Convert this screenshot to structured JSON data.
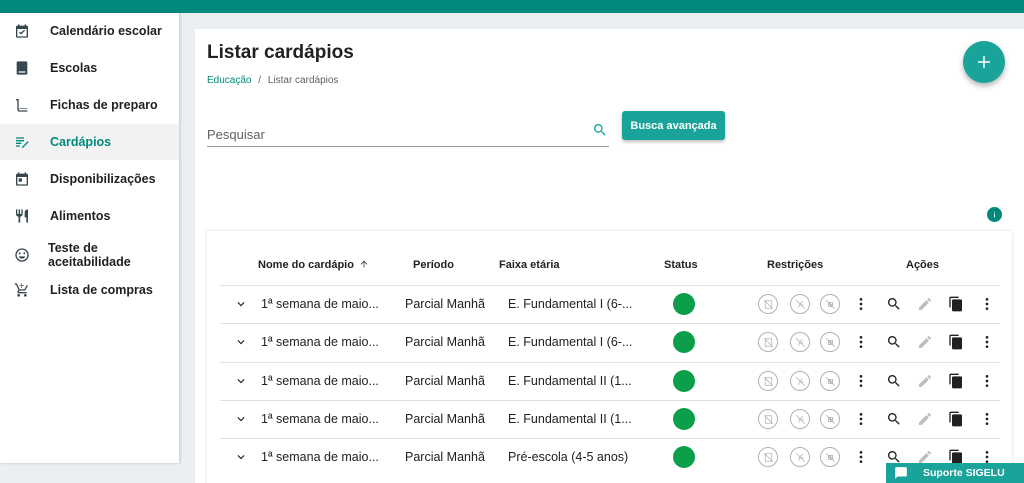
{
  "sidebar": {
    "items": [
      {
        "label": "Calendário escolar",
        "icon": "calendar-check-icon",
        "active": false
      },
      {
        "label": "Escolas",
        "icon": "book-icon",
        "active": false
      },
      {
        "label": "Fichas de preparo",
        "icon": "recipe-book-icon",
        "active": false
      },
      {
        "label": "Cardápios",
        "icon": "menu-edit-icon",
        "active": true
      },
      {
        "label": "Disponibilizações",
        "icon": "calendar-icon",
        "active": false
      },
      {
        "label": "Alimentos",
        "icon": "utensils-icon",
        "active": false
      },
      {
        "label": "Teste de aceitabilidade",
        "icon": "smiley-icon",
        "active": false
      },
      {
        "label": "Lista de compras",
        "icon": "cart-icon",
        "active": false
      }
    ]
  },
  "main": {
    "title": "Listar cardápios",
    "breadcrumb": {
      "root": "Educação",
      "separator": "/",
      "current": "Listar cardápios"
    },
    "search": {
      "placeholder": "Pesquisar",
      "value": ""
    },
    "advanced_search_label": "Busca avançada"
  },
  "table": {
    "headers": {
      "name": "Nome do cardápio",
      "period": "Período",
      "age": "Faixa etária",
      "status": "Status",
      "restrictions": "Restrições",
      "actions": "Ações"
    },
    "rows": [
      {
        "name": "1ª semana de maio...",
        "period": "Parcial Manhã",
        "age": "E. Fundamental I (6-..."
      },
      {
        "name": "1ª semana de maio...",
        "period": "Parcial Manhã",
        "age": "E. Fundamental I (6-..."
      },
      {
        "name": "1ª semana de maio...",
        "period": "Parcial Manhã",
        "age": "E. Fundamental II (1..."
      },
      {
        "name": "1ª semana de maio...",
        "period": "Parcial Manhã",
        "age": "E. Fundamental II (1..."
      },
      {
        "name": "1ª semana de maio...",
        "period": "Parcial Manhã",
        "age": "Pré-escola (4-5 anos)"
      }
    ]
  },
  "support_label": "Suporte SIGELU",
  "colors": {
    "accent": "#1aa39a",
    "topbar": "#00897b",
    "status_active": "#0a9f48"
  }
}
